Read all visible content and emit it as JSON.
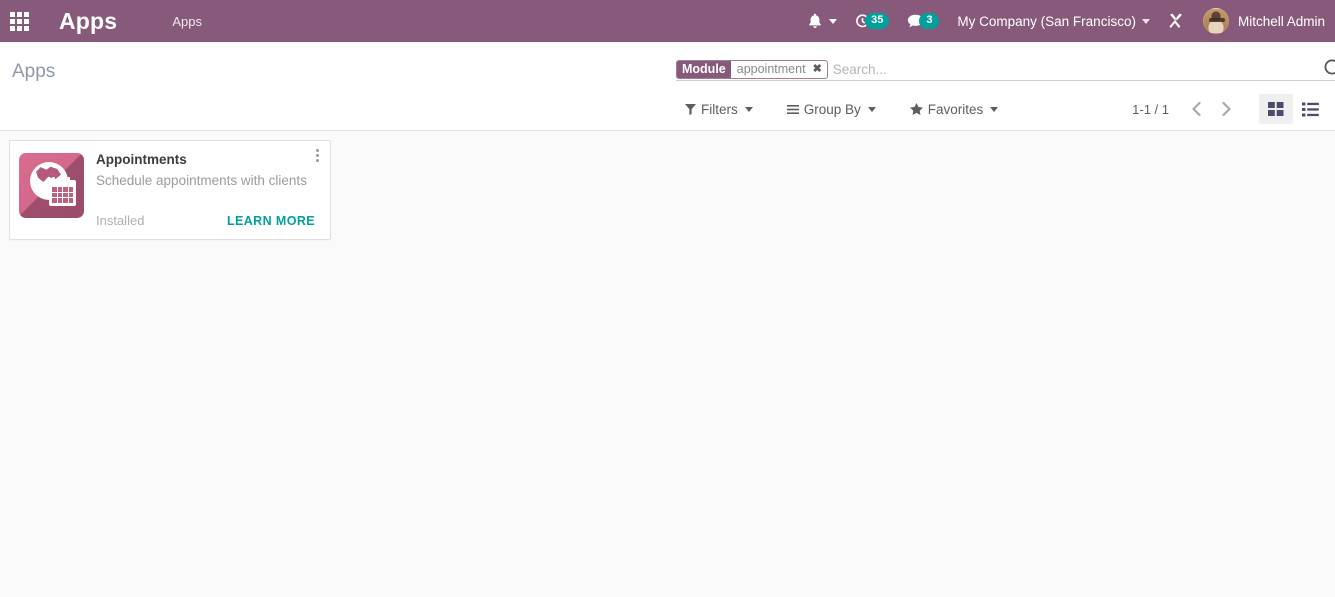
{
  "navbar": {
    "apps_launcher_icon": "grid-apps-icon",
    "brand_title": "Apps",
    "menu_root": "Apps",
    "activity": {
      "icon": "activity-clock-icon",
      "count": "35"
    },
    "messaging": {
      "icon": "chat-bubble-icon",
      "count": "3"
    },
    "notifications_icon": "bell-icon",
    "company": "My Company (San Francisco)",
    "developer_tools_icon": "tools-cross-icon",
    "user": {
      "name": "Mitchell Admin",
      "avatar_icon": "user-avatar"
    },
    "background_color": "#875A7B"
  },
  "control_panel": {
    "breadcrumb": "Apps",
    "search": {
      "facet_label": "Module",
      "facet_value": "appointment",
      "facet_remove_icon": "close-icon",
      "placeholder": "Search...",
      "value": "",
      "search_icon": "search-icon"
    },
    "buttons": {
      "filters": "Filters",
      "filters_icon": "filter-funnel-icon",
      "group_by": "Group By",
      "group_by_icon": "list-lines-icon",
      "favorites": "Favorites",
      "favorites_icon": "star-icon"
    },
    "pager": {
      "range": "1-1 / 1",
      "previous_icon": "chevron-left-icon",
      "next_icon": "chevron-right-icon"
    },
    "views": {
      "kanban_icon": "kanban-grid-icon",
      "list_icon": "list-view-icon",
      "active": "kanban"
    }
  },
  "apps": [
    {
      "name": "Appointments",
      "description": "Schedule appointments with clients",
      "status": "Installed",
      "action_label": "LEARN MORE",
      "menu_icon": "kebab-menu-icon",
      "icon_name": "appointments-app-icon",
      "icon_color": "#C0607F"
    }
  ],
  "colors": {
    "brand_purple": "#875A7B",
    "accent_teal": "#00A09D",
    "page_background": "#FAFAFA"
  }
}
